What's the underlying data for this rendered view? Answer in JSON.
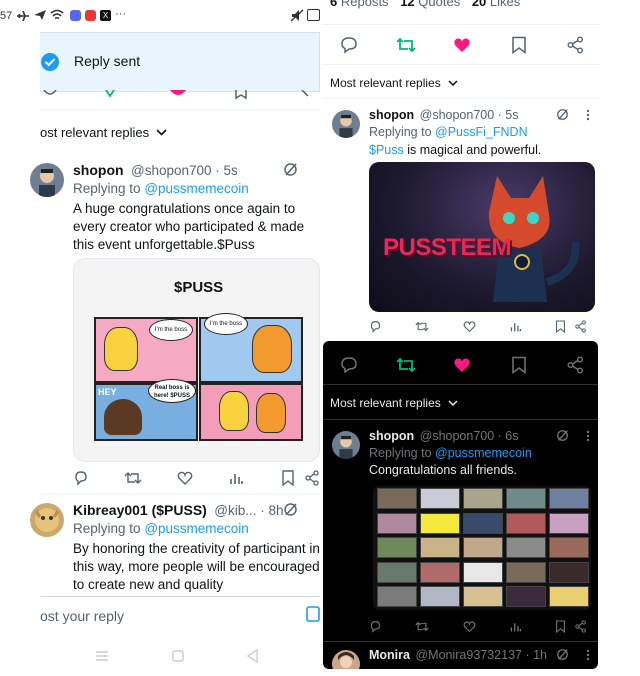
{
  "status_bar": {
    "time": "57",
    "dots": "···"
  },
  "toast": {
    "text": "Reply sent"
  },
  "left": {
    "sort_label": "ost relevant replies",
    "reply1": {
      "name": "shopon",
      "handle": "@shopon700 · 5s",
      "replying_prefix": "Replying to",
      "replying_to": "@pussmemecoin",
      "text": "A huge congratulations once again to every creator who participated & made this event unforgettable.$Puss",
      "comic": {
        "title": "$PUSS",
        "bubble1": "I'm the boss",
        "bubble2": "I'm the boss",
        "bubble3": "Real boss is here! $PUSS",
        "hey": "HEY"
      }
    },
    "reply2": {
      "name": "Kibreay001 ($PUSS)",
      "handle": "@kib... · 8h",
      "replying_prefix": "Replying to",
      "replying_to": "@pussmemecoin",
      "text": "By honoring the creativity of participant in this way, more people will be encouraged to create new and quality"
    },
    "post_reply_placeholder": "ost your reply"
  },
  "right1": {
    "stats": {
      "reposts": "6",
      "reposts_label": "Reposts",
      "quotes": "12",
      "quotes_label": "Quotes",
      "likes": "20",
      "likes_label": "Likes"
    },
    "sort_label": "Most relevant replies",
    "reply": {
      "name": "shopon",
      "handle": "@shopon700 · 5s",
      "replying_prefix": "Replying to",
      "replying_to": "@PussFi_FNDN",
      "hashtag": "$Puss",
      "text_rest": " is magical and powerful.",
      "image_text": "PUSSTEEM"
    }
  },
  "right2": {
    "sort_label": "Most relevant replies",
    "reply": {
      "name": "shopon",
      "handle": "@shopon700 · 6s",
      "replying_prefix": "Replying to",
      "replying_to": "@pussmemecoin",
      "text": "Congratulations all friends."
    },
    "next": {
      "name": "Monira",
      "handle": "@Monira93732137 · 1h"
    }
  },
  "colors": {
    "accent": "#1d9bf0",
    "repost": "#00ba7c",
    "like": "#f91880"
  }
}
